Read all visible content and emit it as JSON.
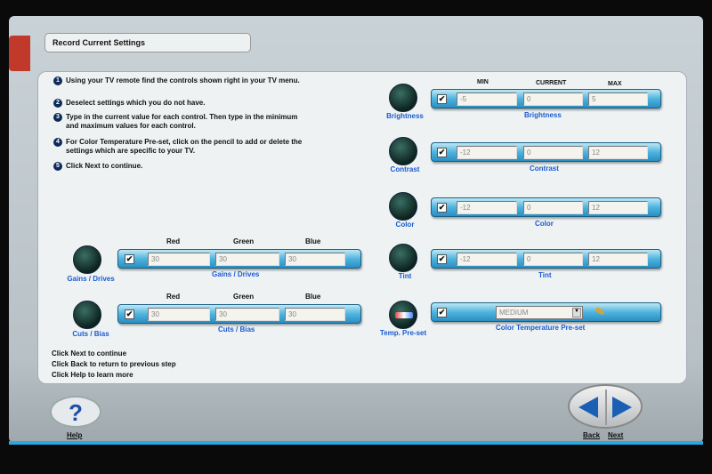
{
  "header": {
    "title": "Record Current Settings"
  },
  "steps": [
    {
      "num": "1",
      "text": "Using your TV remote find the controls shown right in your TV menu."
    },
    {
      "num": "2",
      "text": "Deselect settings which you do not have."
    },
    {
      "num": "3",
      "text": "Type in the current value for each control.  Then type in the minimum and maximum values for each control."
    },
    {
      "num": "4",
      "text": "For Color Temperature Pre-set, click on the pencil to add or delete the settings which are specific to your TV."
    },
    {
      "num": "5",
      "text": "Click Next to continue."
    }
  ],
  "columns": {
    "min": "MIN",
    "current": "CURRENT",
    "max": "MAX",
    "red": "Red",
    "green": "Green",
    "blue": "Blue"
  },
  "controls": [
    {
      "label": "Brightness",
      "checked": "✔",
      "min": "-5",
      "current": "0",
      "max": "5"
    },
    {
      "label": "Contrast",
      "checked": "✔",
      "min": "-12",
      "current": "0",
      "max": "12"
    },
    {
      "label": "Color",
      "checked": "✔",
      "min": "-12",
      "current": "0",
      "max": "12"
    },
    {
      "label": "Tint",
      "checked": "✔",
      "min": "-12",
      "current": "0",
      "max": "12"
    }
  ],
  "temp": {
    "icon_label": "Temp. Pre-set",
    "label": "Color Temperature Pre-set",
    "checked": "✔",
    "value": "MEDIUM"
  },
  "rgb": [
    {
      "label": "Gains / Drives",
      "checked": "✔",
      "red": "30",
      "green": "30",
      "blue": "30"
    },
    {
      "label": "Cuts / Bias",
      "checked": "✔",
      "red": "30",
      "green": "30",
      "blue": "30"
    }
  ],
  "footer": [
    "Click Next to continue",
    "Click Back to return to previous step",
    "Click Help to learn more"
  ],
  "nav": {
    "help": "Help",
    "help_glyph": "?",
    "back": "Back",
    "next": "Next"
  }
}
